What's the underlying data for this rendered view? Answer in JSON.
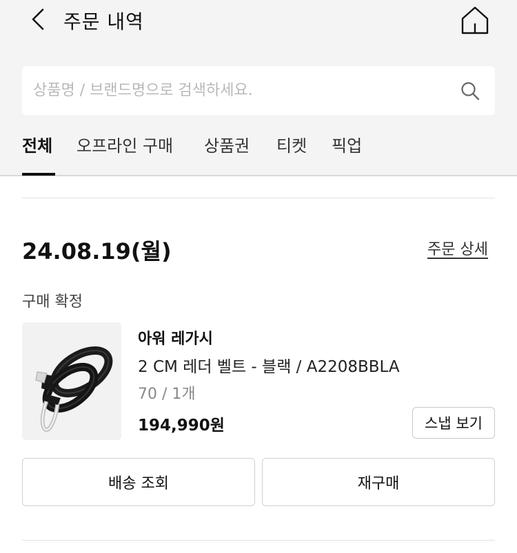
{
  "header": {
    "title": "주문 내역",
    "back_icon": "chevron-left-icon",
    "home_icon": "home-icon"
  },
  "search": {
    "placeholder": "상품명 / 브랜드명으로 검색하세요.",
    "value": "",
    "icon": "search-icon"
  },
  "tabs": [
    {
      "label": "전체",
      "active": true
    },
    {
      "label": "오프라인 구매",
      "active": false
    },
    {
      "label": "상품권",
      "active": false
    },
    {
      "label": "티켓",
      "active": false
    },
    {
      "label": "픽업",
      "active": false
    }
  ],
  "order": {
    "date": "24.08.19(월)",
    "detail_link": "주문 상세",
    "status": "구매 확정",
    "item": {
      "brand": "아워 레가시",
      "name": "2 CM 레더 벨트 - 블랙 / A2208BBLA",
      "option": "70 / 1개",
      "price": "194,990원",
      "snap_button": "스냅 보기"
    },
    "actions": {
      "track": "배송 조회",
      "reorder": "재구매"
    }
  },
  "colors": {
    "header_background": "#f4f4f4",
    "text_primary": "#111111",
    "text_muted": "#888888",
    "border": "#d0d0d0"
  }
}
